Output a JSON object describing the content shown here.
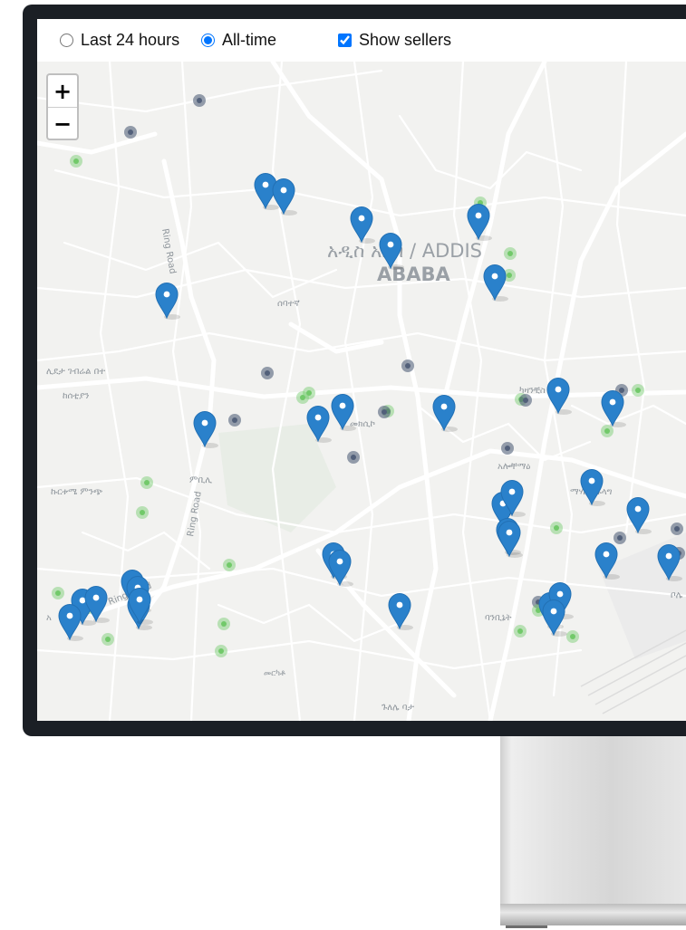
{
  "controls": {
    "last_24_label": "Last 24 hours",
    "all_time_label": "All-time",
    "show_sellers_label": "Show sellers",
    "selected_range": "All-time",
    "show_sellers_checked": true
  },
  "zoom": {
    "in_label": "+",
    "out_label": "−"
  },
  "map": {
    "city_label_line1": "አዲስ አበባ / ADDIS",
    "city_label_line2": "ABABA",
    "road_labels": [
      "Ring Road",
      "Ring Road",
      "Ring Road"
    ],
    "place_labels": [
      "ሰባተኛ",
      "ሊደታ ገብሬል በተ",
      "ከሰቲያን",
      "ኩርቱሜ ምንጭ",
      "ምቢሊ",
      "መክሲኮ",
      "አሎቸማዕ",
      "ካዛንቺስ",
      "ባንቢኔት",
      "ማሃሊፋፋላግ",
      "ጉለሌ ባታ",
      "መርካቶ",
      "ቦሌ",
      "አ"
    ],
    "colors": {
      "background": "#f2f2f0",
      "road": "#ffffff",
      "pin": "#2a81cb",
      "seller_green": "#72c96a",
      "seller_dark": "#52607a"
    }
  }
}
